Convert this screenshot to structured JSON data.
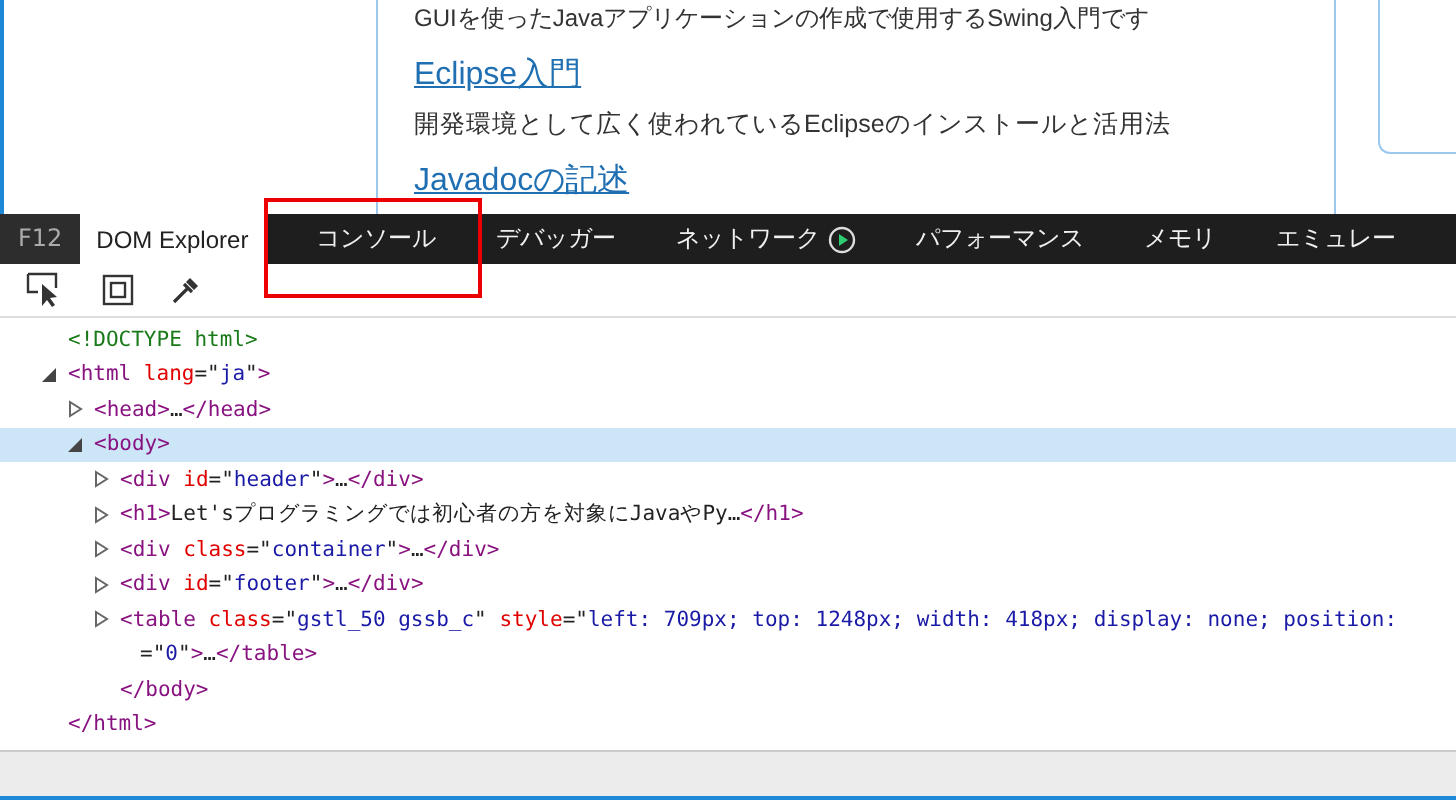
{
  "page": {
    "intro": "GUIを使ったJavaアプリケーションの作成で使用するSwing入門です",
    "sections": [
      {
        "title": "Eclipse入門",
        "description": "開発環境として広く使われているEclipseのインストールと活用法"
      },
      {
        "title": "Javadocの記述"
      }
    ]
  },
  "devtools": {
    "label": "F12",
    "tabs": [
      {
        "label": "DOM Explorer",
        "selected": true,
        "highlighted": false
      },
      {
        "label": "コンソール",
        "selected": false,
        "highlighted": true
      },
      {
        "label": "デバッガー",
        "selected": false,
        "highlighted": false
      },
      {
        "label": "ネットワーク",
        "selected": false,
        "highlighted": false,
        "recording": true
      },
      {
        "label": "パフォーマンス",
        "selected": false,
        "highlighted": false
      },
      {
        "label": "メモリ",
        "selected": false,
        "highlighted": false
      },
      {
        "label": "エミュレー",
        "selected": false,
        "highlighted": false
      }
    ],
    "tree": [
      {
        "segments": [
          {
            "kind": "doctype",
            "text": "<!DOCTYPE html>"
          }
        ]
      },
      {
        "expandable": true,
        "expanded": true,
        "selected": false,
        "segments": [
          {
            "kind": "tag",
            "text": "<html"
          },
          {
            "kind": "attr",
            "text": " lang"
          },
          {
            "kind": "punct",
            "text": "=\""
          },
          {
            "kind": "value",
            "text": "ja"
          },
          {
            "kind": "punct",
            "text": "\""
          },
          {
            "kind": "tag",
            "text": ">"
          }
        ],
        "children": [
          {
            "expandable": true,
            "expanded": false,
            "selected": false,
            "segments": [
              {
                "kind": "tag",
                "text": "<head>"
              },
              {
                "kind": "text",
                "text": "…"
              },
              {
                "kind": "tag",
                "text": "</head>"
              }
            ]
          },
          {
            "expandable": true,
            "expanded": true,
            "selected": true,
            "segments": [
              {
                "kind": "tag",
                "text": "<body>"
              }
            ],
            "children": [
              {
                "expandable": true,
                "expanded": false,
                "selected": false,
                "segments": [
                  {
                    "kind": "tag",
                    "text": "<div"
                  },
                  {
                    "kind": "attr",
                    "text": " id"
                  },
                  {
                    "kind": "punct",
                    "text": "=\""
                  },
                  {
                    "kind": "value",
                    "text": "header"
                  },
                  {
                    "kind": "punct",
                    "text": "\""
                  },
                  {
                    "kind": "tag",
                    "text": ">"
                  },
                  {
                    "kind": "text",
                    "text": "…"
                  },
                  {
                    "kind": "tag",
                    "text": "</div>"
                  }
                ]
              },
              {
                "expandable": true,
                "expanded": false,
                "selected": false,
                "segments": [
                  {
                    "kind": "tag",
                    "text": "<h1>"
                  },
                  {
                    "kind": "text",
                    "text": "Let'sプログラミングでは初心者の方を対象にJavaやPy…"
                  },
                  {
                    "kind": "tag",
                    "text": "</h1>"
                  }
                ]
              },
              {
                "expandable": true,
                "expanded": false,
                "selected": false,
                "segments": [
                  {
                    "kind": "tag",
                    "text": "<div"
                  },
                  {
                    "kind": "attr",
                    "text": " class"
                  },
                  {
                    "kind": "punct",
                    "text": "=\""
                  },
                  {
                    "kind": "value",
                    "text": "container"
                  },
                  {
                    "kind": "punct",
                    "text": "\""
                  },
                  {
                    "kind": "tag",
                    "text": ">"
                  },
                  {
                    "kind": "text",
                    "text": "…"
                  },
                  {
                    "kind": "tag",
                    "text": "</div>"
                  }
                ]
              },
              {
                "expandable": true,
                "expanded": false,
                "selected": false,
                "segments": [
                  {
                    "kind": "tag",
                    "text": "<div"
                  },
                  {
                    "kind": "attr",
                    "text": " id"
                  },
                  {
                    "kind": "punct",
                    "text": "=\""
                  },
                  {
                    "kind": "value",
                    "text": "footer"
                  },
                  {
                    "kind": "punct",
                    "text": "\""
                  },
                  {
                    "kind": "tag",
                    "text": ">"
                  },
                  {
                    "kind": "text",
                    "text": "…"
                  },
                  {
                    "kind": "tag",
                    "text": "</div>"
                  }
                ]
              },
              {
                "expandable": true,
                "expanded": false,
                "selected": false,
                "segments": [
                  {
                    "kind": "tag",
                    "text": "<table"
                  },
                  {
                    "kind": "attr",
                    "text": " class"
                  },
                  {
                    "kind": "punct",
                    "text": "=\""
                  },
                  {
                    "kind": "value",
                    "text": "gstl_50 gssb_c"
                  },
                  {
                    "kind": "punct",
                    "text": "\""
                  },
                  {
                    "kind": "attr",
                    "text": " style"
                  },
                  {
                    "kind": "punct",
                    "text": "=\""
                  },
                  {
                    "kind": "value",
                    "text": "left: 709px; top: 1248px; width: 418px; display: none; position:"
                  }
                ],
                "continuation": [
                  {
                    "kind": "punct",
                    "text": "=\""
                  },
                  {
                    "kind": "value",
                    "text": "0"
                  },
                  {
                    "kind": "punct",
                    "text": "\""
                  },
                  {
                    "kind": "tag",
                    "text": ">"
                  },
                  {
                    "kind": "text",
                    "text": "…"
                  },
                  {
                    "kind": "tag",
                    "text": "</table>"
                  }
                ]
              },
              {
                "segments": [
                  {
                    "kind": "tag",
                    "text": "</body>"
                  }
                ]
              }
            ]
          }
        ]
      },
      {
        "segments": [
          {
            "kind": "tag",
            "text": "</html>"
          }
        ]
      }
    ]
  }
}
